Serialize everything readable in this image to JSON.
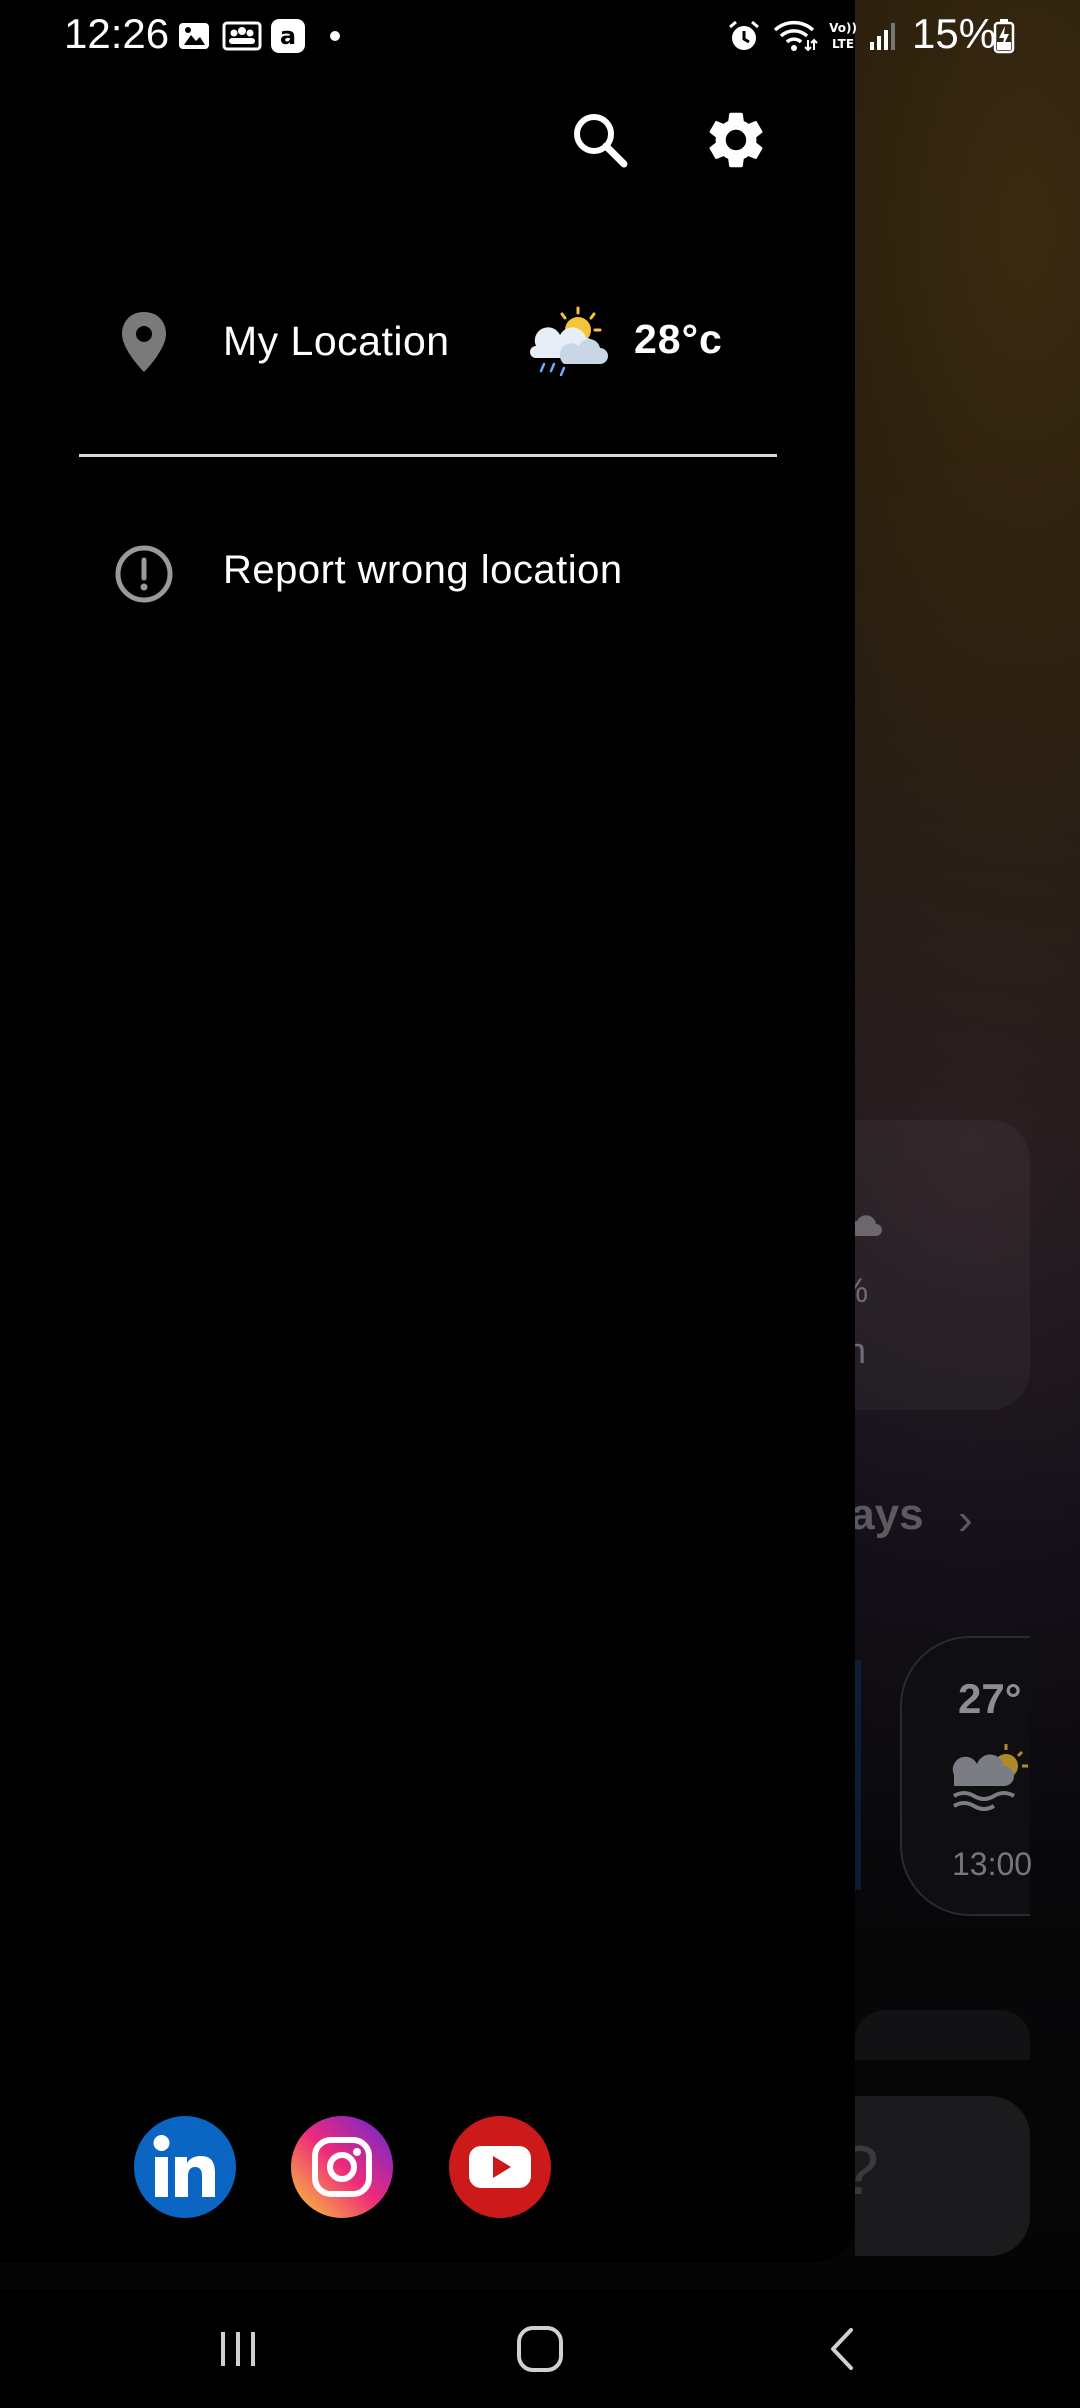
{
  "status_bar": {
    "time": "12:26",
    "battery_percent": "15%"
  },
  "drawer": {
    "location": {
      "label": "My Location",
      "temperature": "28°c",
      "weather_icon": "partly-cloudy-rain-icon"
    },
    "report": {
      "label": "Report wrong location"
    },
    "social": [
      "linkedin-icon",
      "instagram-icon",
      "youtube-icon"
    ]
  },
  "background_app": {
    "precip_value": "%",
    "precip_label": "in",
    "days_label": "lays",
    "hour_temp": "27°",
    "hour_time": "13:00"
  },
  "colors": {
    "linkedin": "#0a66c2",
    "youtube": "#cc1a1a",
    "drawer_bg": "#000000"
  }
}
